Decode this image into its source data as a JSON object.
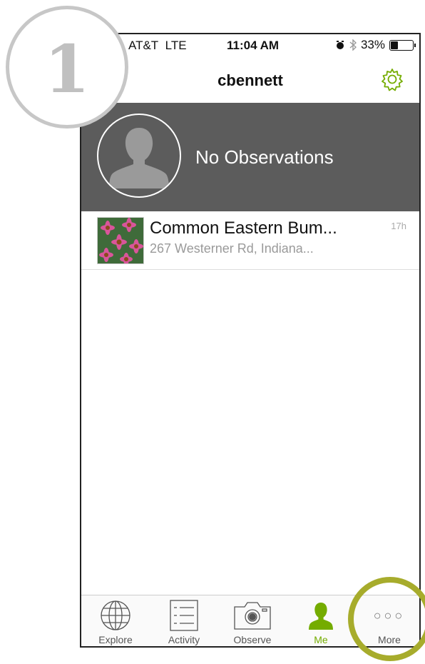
{
  "annotation": {
    "step_number": "1"
  },
  "status_bar": {
    "carrier": "AT&T",
    "network": "LTE",
    "time": "11:04 AM",
    "battery_text": "33%",
    "battery_level": 0.33
  },
  "nav": {
    "title": "cbennett"
  },
  "profile": {
    "observation_count_text": "No Observations"
  },
  "observations": [
    {
      "title": "Common Eastern Bum...",
      "place": "267 Westerner Rd, Indiana...",
      "time_ago": "17h"
    }
  ],
  "tabs": [
    {
      "label": "Explore",
      "icon": "globe-icon",
      "active": false
    },
    {
      "label": "Activity",
      "icon": "list-icon",
      "active": false
    },
    {
      "label": "Observe",
      "icon": "camera-icon",
      "active": false
    },
    {
      "label": "Me",
      "icon": "person-icon",
      "active": true
    },
    {
      "label": "More",
      "icon": "more-dots-icon",
      "active": false
    }
  ],
  "colors": {
    "accent": "#74ac00",
    "profile_bg": "#5c5c5c",
    "highlight_ring": "#a7ac2c",
    "badge_gray": "#c7c7c7"
  }
}
